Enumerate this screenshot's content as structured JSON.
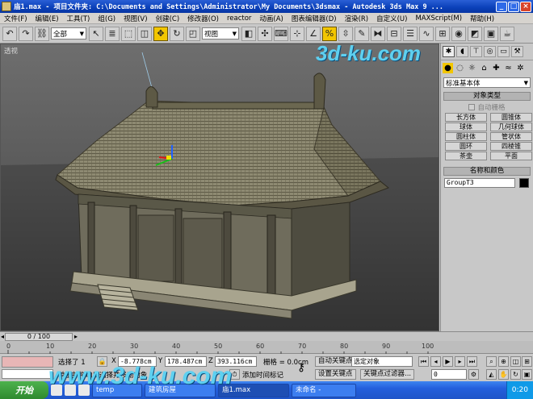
{
  "titlebar": {
    "title": "庙1.max    - 项目文件夹: C:\\Documents and Settings\\Administrator\\My Documents\\3dsmax    - Autodesk 3ds Max 9   ...",
    "minimize": "_",
    "maximize": "□",
    "close": "×"
  },
  "menu": {
    "items": [
      "文件(F)",
      "编辑(E)",
      "工具(T)",
      "组(G)",
      "视图(V)",
      "创建(C)",
      "修改器(O)",
      "reactor",
      "动画(A)",
      "图表编辑器(D)",
      "渲染(R)",
      "自定义(U)",
      "MAXScript(M)",
      "帮助(H)"
    ]
  },
  "toolbar": {
    "selection_filter": "全部",
    "reference_coord": "视图"
  },
  "viewport": {
    "label": "透视"
  },
  "watermark": {
    "text_top": "3d-ku.com",
    "text_bottom": "www.3d-ku.com"
  },
  "command_panel": {
    "category": "标准基本体",
    "object_type_title": "对象类型",
    "autogrid": "自动栅格",
    "objects": [
      "长方体",
      "圆锥体",
      "球体",
      "几何球体",
      "圆柱体",
      "管状体",
      "圆环",
      "四棱锥",
      "茶壶",
      "平面"
    ],
    "name_color_title": "名称和颜色",
    "object_name": "GroupT3"
  },
  "timeline": {
    "position": "0 / 100",
    "ticks": [
      "0",
      "10",
      "20",
      "30",
      "40",
      "50",
      "60",
      "70",
      "80",
      "90",
      "100"
    ]
  },
  "status": {
    "selection": "选择了 1",
    "x_label": "X",
    "x_value": "-8.778cm",
    "y_label": "Y",
    "y_value": "178.487cm",
    "z_label": "Z",
    "z_value": "393.116cm",
    "grid": "栅格 = 0.0cm",
    "prompt": "单击并拖动以选择并移动对象",
    "add_time_tag": "添加时间标记",
    "auto_key": "自动关键点",
    "set_key": "设置关键点",
    "selected_object": "选定对象",
    "key_filters": "关键点过滤器...",
    "frame": "0"
  },
  "taskbar": {
    "start": "开始",
    "tasks": [
      "temp",
      "建筑房屋",
      "庙1.max",
      "未命名 -"
    ],
    "clock": "0:20"
  },
  "colors": {
    "titlebar": "#0a3fb8",
    "active_tool": "#f2c600",
    "viewport_bg": "#7a7a7a"
  }
}
